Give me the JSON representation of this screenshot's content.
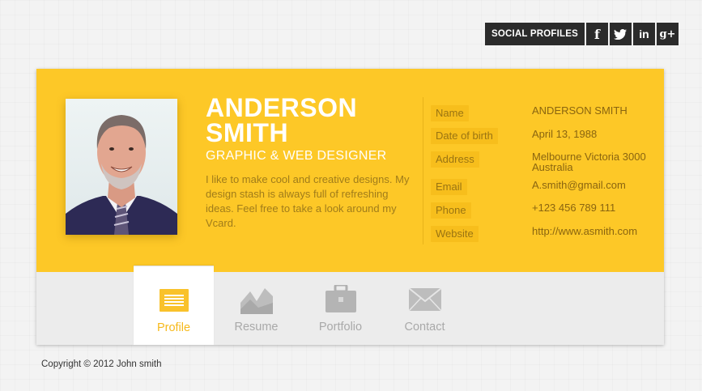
{
  "social": {
    "label": "SOCIAL PROFILES",
    "buttons": [
      {
        "icon": "facebook-icon",
        "glyph": "f"
      },
      {
        "icon": "twitter-icon",
        "glyph": ""
      },
      {
        "icon": "linkedin-icon",
        "glyph": "in"
      },
      {
        "icon": "google-plus-icon",
        "glyph": "g+"
      }
    ]
  },
  "profile": {
    "first_name": "ANDERSON",
    "last_name": "SMITH",
    "role": "GRAPHIC & WEB DESIGNER",
    "bio": "I like to make cool and creative designs. My design stash is always full of refreshing ideas. Feel free to take a look around my Vcard."
  },
  "info": [
    {
      "label": "Name",
      "value": "ANDERSON SMITH"
    },
    {
      "label": "Date of birth",
      "value": "April 13, 1988"
    },
    {
      "label": "Address",
      "value": "Melbourne Victoria 3000 Australia"
    },
    {
      "label": "Email",
      "value": "A.smith@gmail.com"
    },
    {
      "label": "Phone",
      "value": "+123 456 789 111"
    },
    {
      "label": "Website",
      "value": "http://www.asmith.com"
    }
  ],
  "tabs": [
    {
      "label": "Profile",
      "icon": "profile-icon",
      "active": true
    },
    {
      "label": "Resume",
      "icon": "resume-chart-icon",
      "active": false
    },
    {
      "label": "Portfolio",
      "icon": "briefcase-icon",
      "active": false
    },
    {
      "label": "Contact",
      "icon": "envelope-icon",
      "active": false
    }
  ],
  "footer": {
    "copyright": "Copyright © 2012 John smith"
  },
  "colors": {
    "accent": "#fdc827",
    "dark": "#2b2b2b",
    "active_tab": "#f6b91a"
  }
}
